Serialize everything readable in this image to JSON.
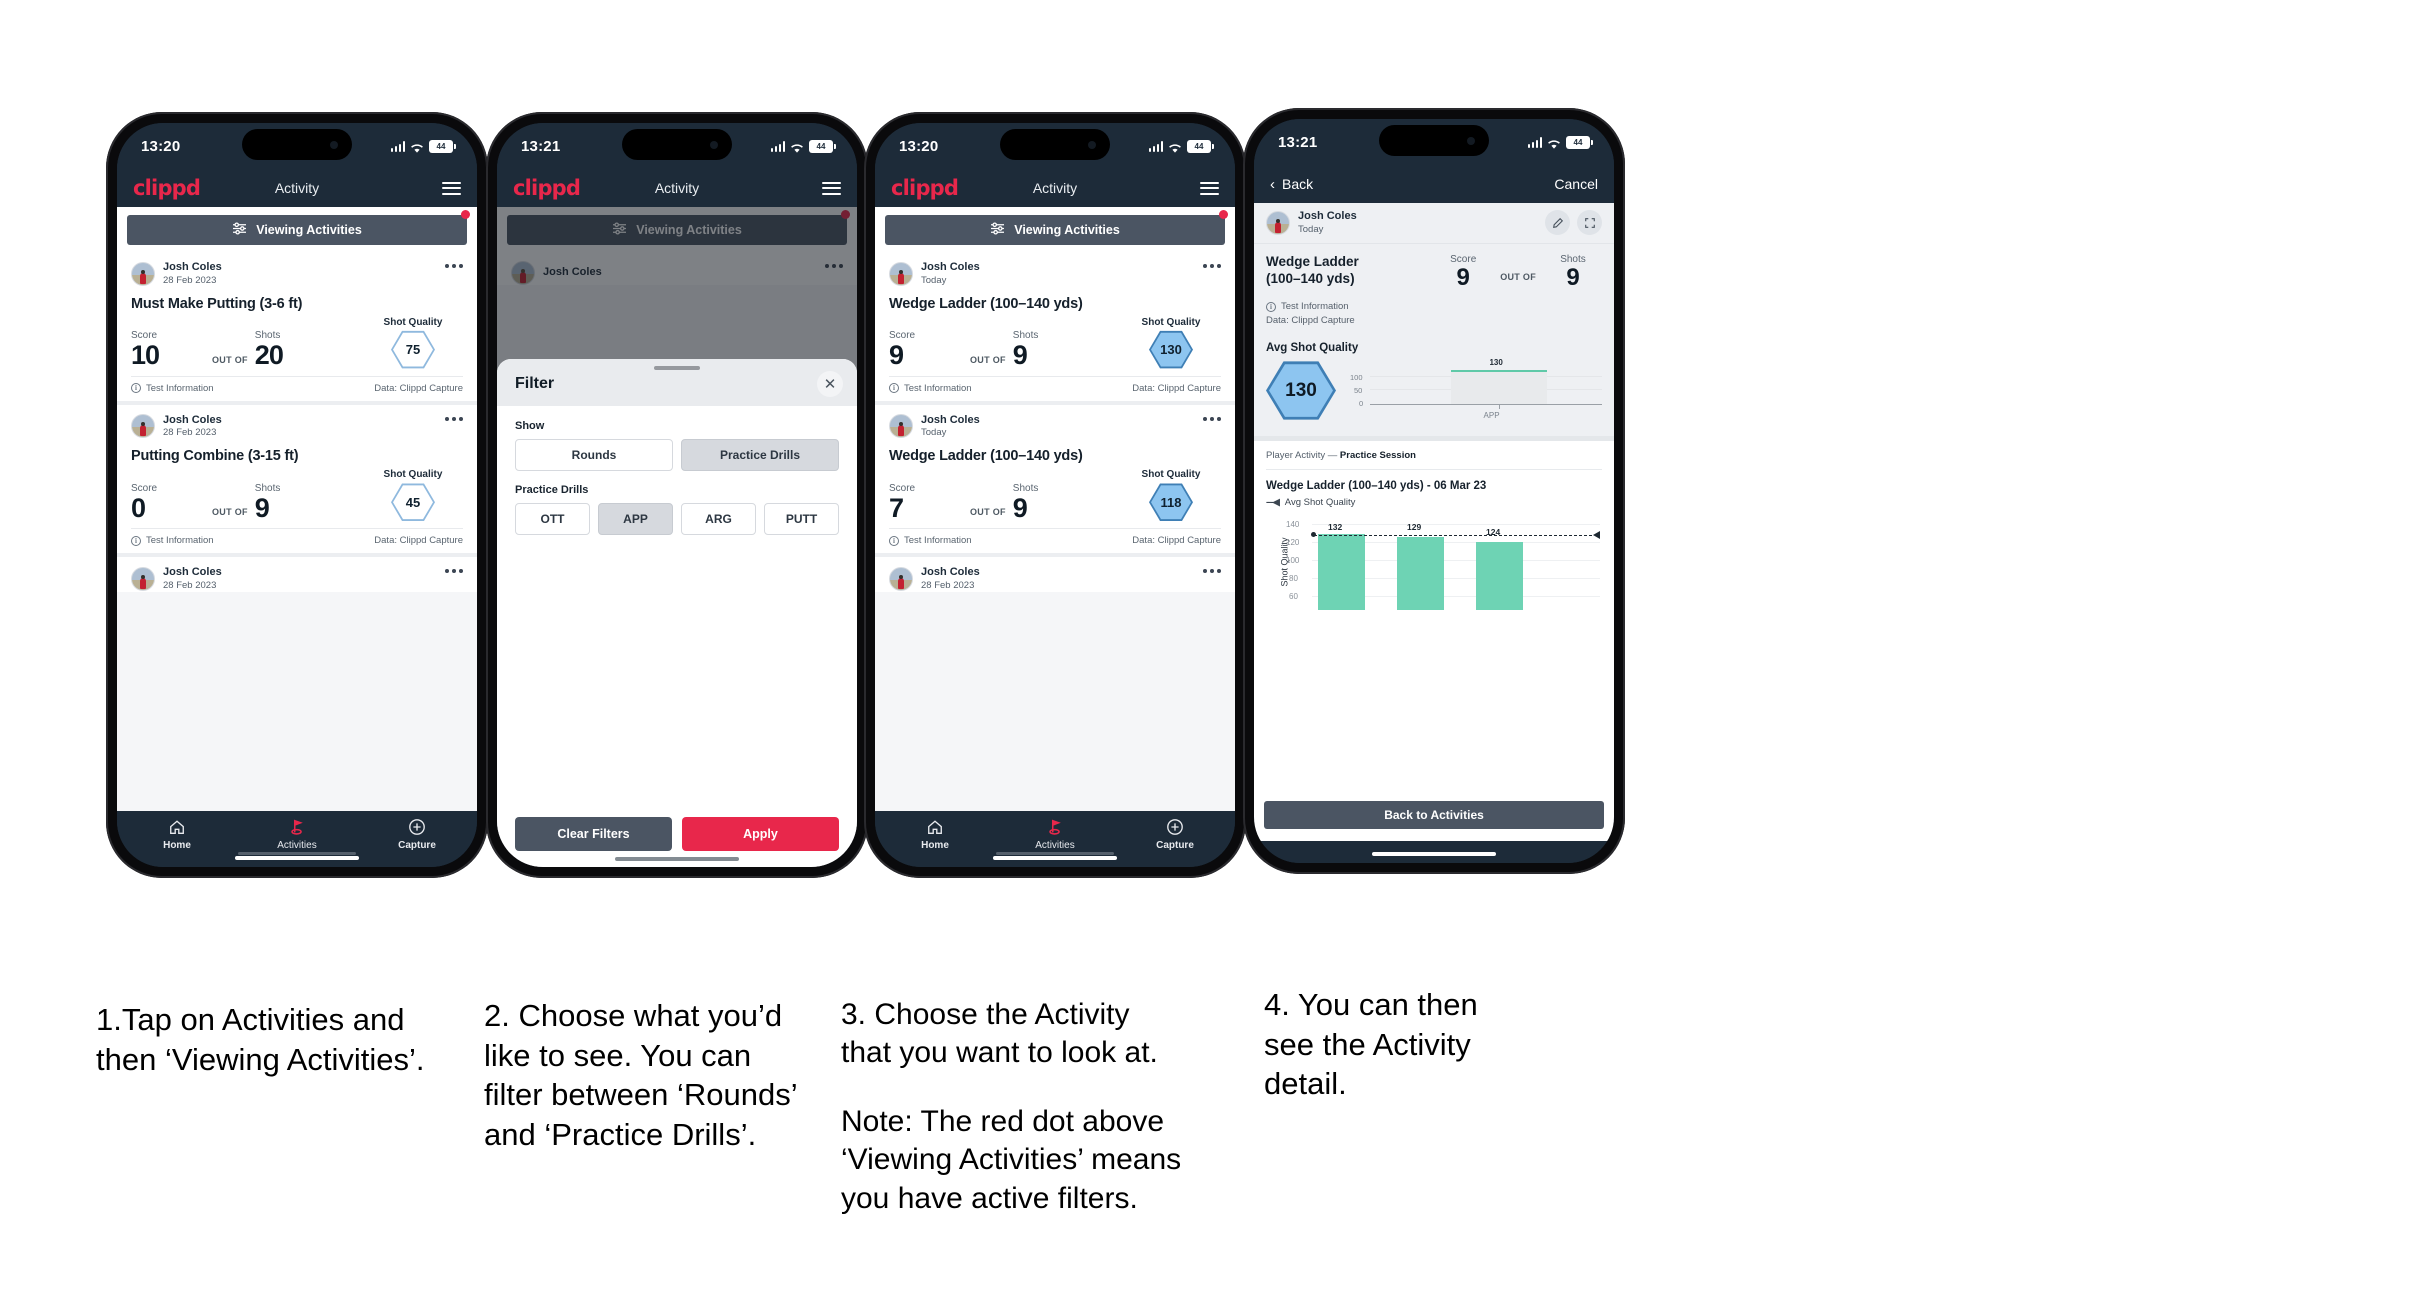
{
  "phones": [
    {
      "id": "phone-1",
      "status": {
        "time": "13:20",
        "battery": "44"
      },
      "header": {
        "logo": "clippd",
        "title": "Activity",
        "menu_icon": "hamburger-icon"
      },
      "filter_bar": {
        "label": "Viewing Activities",
        "icon": "sliders-icon",
        "has_active_filters": true
      },
      "cards": [
        {
          "user": "Josh Coles",
          "date": "28 Feb 2023",
          "title": "Must Make Putting (3-6 ft)",
          "score_label": "Score",
          "score": "10",
          "out_of_label": "OUT OF",
          "shots_label": "Shots",
          "shots": "20",
          "quality_label": "Shot Quality",
          "quality": "75",
          "quality_style": "outline",
          "footer_left": "Test Information",
          "footer_right": "Data: Clippd Capture"
        },
        {
          "user": "Josh Coles",
          "date": "28 Feb 2023",
          "title": "Putting Combine (3-15 ft)",
          "score_label": "Score",
          "score": "0",
          "out_of_label": "OUT OF",
          "shots_label": "Shots",
          "shots": "9",
          "quality_label": "Shot Quality",
          "quality": "45",
          "quality_style": "outline",
          "footer_left": "Test Information",
          "footer_right": "Data: Clippd Capture"
        }
      ],
      "partial_card": {
        "user": "Josh Coles",
        "date": "28 Feb 2023"
      },
      "tabbar": [
        {
          "label": "Home",
          "icon": "home-icon",
          "active": false
        },
        {
          "label": "Activities",
          "icon": "golf-flag-icon",
          "active": true
        },
        {
          "label": "Capture",
          "icon": "plus-circle-icon",
          "active": false
        }
      ]
    },
    {
      "id": "phone-2",
      "status": {
        "time": "13:21",
        "battery": "44"
      },
      "header": {
        "logo": "clippd",
        "title": "Activity",
        "menu_icon": "hamburger-icon"
      },
      "filter_bar": {
        "label": "Viewing Activities",
        "icon": "sliders-icon",
        "has_active_filters": true
      },
      "behind_card": {
        "user": "Josh Coles"
      },
      "sheet": {
        "title": "Filter",
        "close_icon": "close-icon",
        "groups": [
          {
            "label": "Show",
            "options": [
              {
                "text": "Rounds",
                "selected": false
              },
              {
                "text": "Practice Drills",
                "selected": true
              }
            ]
          },
          {
            "label": "Practice Drills",
            "options": [
              {
                "text": "OTT",
                "selected": false
              },
              {
                "text": "APP",
                "selected": true
              },
              {
                "text": "ARG",
                "selected": false
              },
              {
                "text": "PUTT",
                "selected": false
              }
            ]
          }
        ],
        "clear_label": "Clear Filters",
        "apply_label": "Apply"
      }
    },
    {
      "id": "phone-3",
      "status": {
        "time": "13:20",
        "battery": "44"
      },
      "header": {
        "logo": "clippd",
        "title": "Activity",
        "menu_icon": "hamburger-icon"
      },
      "filter_bar": {
        "label": "Viewing Activities",
        "icon": "sliders-icon",
        "has_active_filters": true
      },
      "cards": [
        {
          "user": "Josh Coles",
          "date": "Today",
          "title": "Wedge Ladder (100–140 yds)",
          "score_label": "Score",
          "score": "9",
          "out_of_label": "OUT OF",
          "shots_label": "Shots",
          "shots": "9",
          "quality_label": "Shot Quality",
          "quality": "130",
          "quality_style": "filled",
          "footer_left": "Test Information",
          "footer_right": "Data: Clippd Capture"
        },
        {
          "user": "Josh Coles",
          "date": "Today",
          "title": "Wedge Ladder (100–140 yds)",
          "score_label": "Score",
          "score": "7",
          "out_of_label": "OUT OF",
          "shots_label": "Shots",
          "shots": "9",
          "quality_label": "Shot Quality",
          "quality": "118",
          "quality_style": "filled",
          "footer_left": "Test Information",
          "footer_right": "Data: Clippd Capture"
        }
      ],
      "partial_card": {
        "user": "Josh Coles",
        "date": "28 Feb 2023"
      },
      "tabbar": [
        {
          "label": "Home",
          "icon": "home-icon",
          "active": false
        },
        {
          "label": "Activities",
          "icon": "golf-flag-icon",
          "active": true
        },
        {
          "label": "Capture",
          "icon": "plus-circle-icon",
          "active": false
        }
      ]
    },
    {
      "id": "phone-4",
      "status": {
        "time": "13:21",
        "battery": "44"
      },
      "navbar": {
        "back": "Back",
        "cancel": "Cancel",
        "back_icon": "chevron-left-icon"
      },
      "detail": {
        "user": "Josh Coles",
        "date": "Today",
        "edit_icon": "pencil-icon",
        "expand_icon": "expand-icon",
        "title": "Wedge Ladder\n(100–140 yds)",
        "title_line1": "Wedge Ladder",
        "title_line2": "(100–140 yds)",
        "score_label": "Score",
        "score": "9",
        "out_of_label": "OUT OF",
        "shots_label": "Shots",
        "shots": "9",
        "info_line": "Test Information",
        "data_line": "Data: Clippd Capture",
        "avg_label": "Avg Shot Quality",
        "avg_value": "130",
        "breadcrumb_prefix": "Player Activity — ",
        "breadcrumb_bold": "Practice Session",
        "section_title": "Wedge Ladder (100–140 yds) - 06 Mar 23",
        "legend_label": "Avg Shot Quality",
        "legend_dash": "---◀",
        "back_button": "Back to Activities"
      },
      "chart_data": [
        {
          "type": "bar",
          "title": "Avg Shot Quality",
          "categories": [
            "APP"
          ],
          "values": [
            130
          ],
          "data_labels": [
            "130"
          ],
          "ylabel": "",
          "xlabel": "",
          "ytick_labels": [
            "0",
            "50",
            "100"
          ],
          "yticks": [
            0,
            50,
            100
          ],
          "ylim": [
            0,
            140
          ],
          "grid": true,
          "legend": false,
          "bar_color": "#e8eaec",
          "bar_top_color": "#5fc9a8"
        },
        {
          "type": "bar",
          "title": "Wedge Ladder (100–140 yds) - 06 Mar 23",
          "categories": [
            "1",
            "2",
            "3"
          ],
          "values": [
            132,
            129,
            124
          ],
          "data_labels": [
            "132",
            "129",
            "124"
          ],
          "ylabel": "Shot Quality",
          "xlabel": "",
          "ytick_labels": [
            "60",
            "80",
            "100",
            "120",
            "140"
          ],
          "yticks": [
            60,
            80,
            100,
            120,
            140
          ],
          "ylim": [
            50,
            145
          ],
          "grid": true,
          "legend": true,
          "legend_entries": [
            "Avg Shot Quality"
          ],
          "legend_position": "above-plot",
          "bar_color": "#6ed3b4",
          "annotation": {
            "type": "trend-dashed-line",
            "from": 132,
            "to": 124
          }
        }
      ]
    }
  ],
  "captions": [
    {
      "id": "caption-1",
      "lines": [
        "1.Tap on Activities and",
        "then ‘Viewing Activities’."
      ]
    },
    {
      "id": "caption-2",
      "lines": [
        "2. Choose what you’d",
        "like to see. You can",
        "filter between ‘Rounds’",
        "and ‘Practice Drills’."
      ]
    },
    {
      "id": "caption-3",
      "lines": [
        "3. Choose the Activity",
        "that you want to look at.",
        "",
        "Note: The red dot above",
        "‘Viewing Activities’ means",
        "you have active filters."
      ]
    },
    {
      "id": "caption-4",
      "lines": [
        "4. You can then",
        "see the Activity",
        "detail."
      ]
    }
  ],
  "colors": {
    "brand_red": "#e8274b",
    "dark_navy": "#1d2b39",
    "slate": "#4b5563",
    "hex_blue_fill": "#8dc5f0",
    "hex_blue_stroke": "#3f7fb5",
    "chart_teal": "#6ed3b4"
  }
}
